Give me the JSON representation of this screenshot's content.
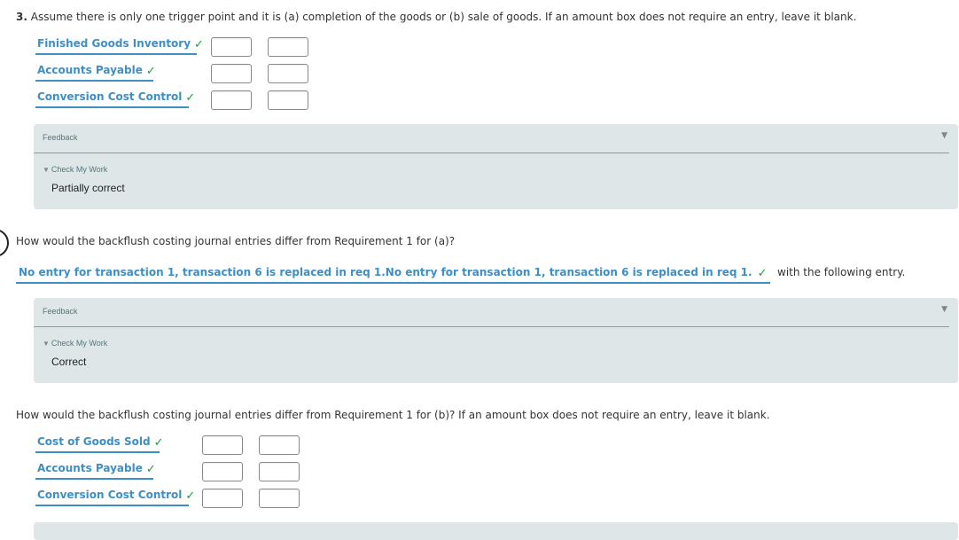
{
  "part3": {
    "number": "3.",
    "instruction": "Assume there is only one trigger point and it is (a) completion of the goods or (b) sale of goods. If an amount box does not require an entry, leave it blank.",
    "entries": [
      {
        "account": "Finished Goods Inventory",
        "debit": "",
        "credit": "",
        "status": "correct"
      },
      {
        "account": "Accounts Payable",
        "debit": "",
        "credit": "",
        "status": "correct"
      },
      {
        "account": "Conversion Cost Control",
        "debit": "",
        "credit": "",
        "status": "correct"
      }
    ],
    "feedback": {
      "title": "Feedback",
      "check_my_work": "Check My Work",
      "result": "Partially correct"
    }
  },
  "question_a": {
    "prompt": "How would the backflush costing journal entries differ from Requirement 1 for (a)?",
    "selected_answer": "No entry for transaction 1, transaction 6 is replaced in req 1.No entry for transaction 1, transaction 6 is replaced in req 1.",
    "status": "correct",
    "suffix": "with the following entry.",
    "feedback": {
      "title": "Feedback",
      "check_my_work": "Check My Work",
      "result": "Correct"
    }
  },
  "question_b": {
    "prompt": "How would the backflush costing journal entries differ from Requirement 1 for (b)? If an amount box does not require an entry, leave it blank.",
    "entries": [
      {
        "account": "Cost of Goods Sold",
        "debit": "",
        "credit": "",
        "status": "correct"
      },
      {
        "account": "Accounts Payable",
        "debit": "",
        "credit": "",
        "status": "correct"
      },
      {
        "account": "Conversion Cost Control",
        "debit": "",
        "credit": "",
        "status": "correct"
      }
    ]
  },
  "icons": {
    "check": "✓",
    "expand": "▼",
    "disclosure": "▼"
  },
  "colors": {
    "accent": "#3d8fc6",
    "check": "#1a9e3a",
    "feedback_bg": "#dee6e8",
    "feedback_text": "#4d7a80"
  }
}
